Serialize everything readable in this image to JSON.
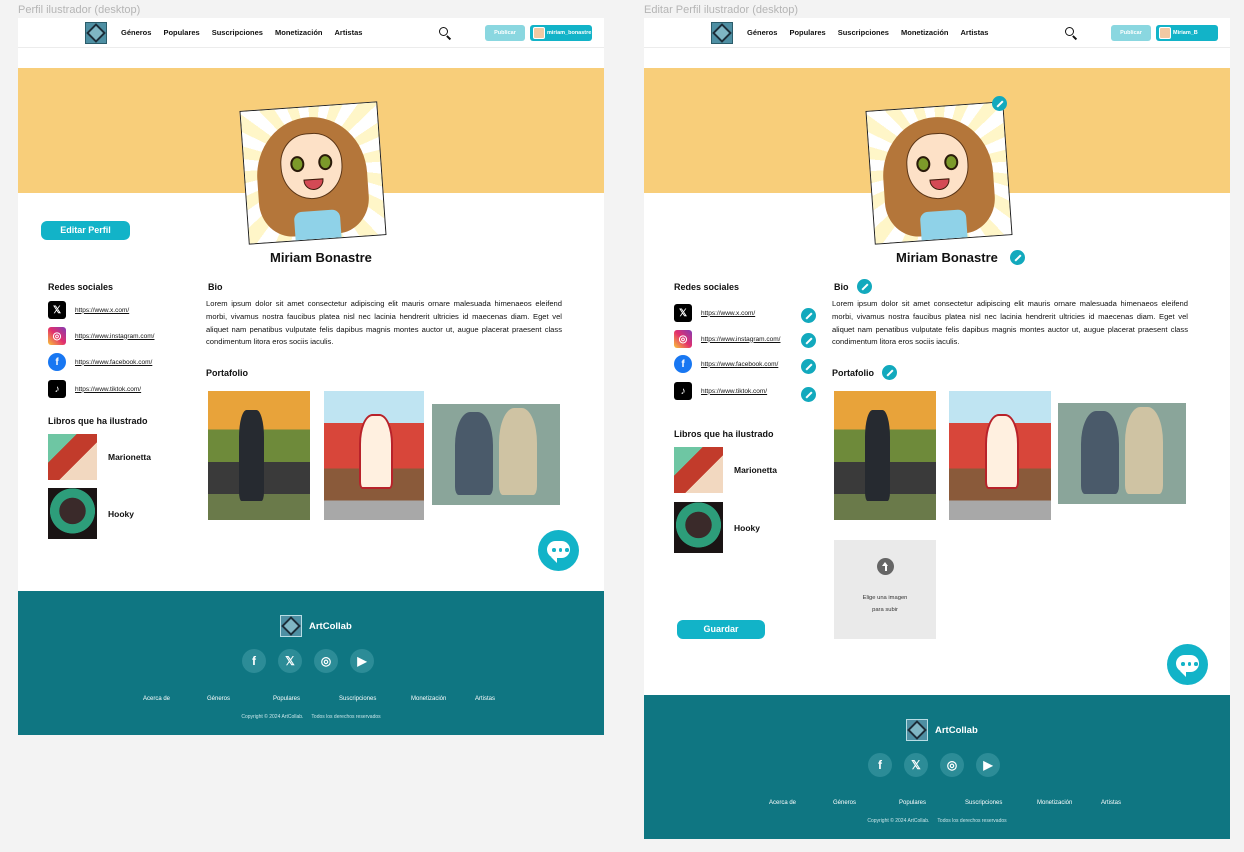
{
  "frames": {
    "view_label": "Perfil ilustrador (desktop)",
    "edit_label": "Editar Perfil ilustrador (desktop)"
  },
  "nav": {
    "links": [
      "Géneros",
      "Populares",
      "Suscripciones",
      "Monetización",
      "Artistas"
    ],
    "publish_label": "Publicar",
    "user_view": "miriam_bonastre",
    "user_edit": "Miriam_B"
  },
  "profile": {
    "name": "Miriam Bonastre",
    "edit_button": "Editar Perfil",
    "save_button": "Guardar"
  },
  "social": {
    "heading": "Redes sociales",
    "items": [
      {
        "icon": "x-icon",
        "url": "https://www.x.com/"
      },
      {
        "icon": "instagram-icon",
        "url": "https://www.instagram.com/"
      },
      {
        "icon": "facebook-icon",
        "url": "https://www.facebook.com/"
      },
      {
        "icon": "tiktok-icon",
        "url": "https://www.tiktok.com/"
      }
    ]
  },
  "books": {
    "heading": "Libros que ha ilustrado",
    "items": [
      "Marionetta",
      "Hooky"
    ]
  },
  "bio": {
    "heading": "Bio",
    "text": "Lorem ipsum dolor sit amet consectetur adipiscing elit mauris ornare malesuada himenaeos eleifend morbi, vivamus nostra faucibus platea nisl nec lacinia hendrerit ultricies id maecenas diam. Eget vel aliquet nam penatibus vulputate felis dapibus magnis montes auctor ut, augue placerat praesent class condimentum litora eros sociis iaculis."
  },
  "portfolio": {
    "heading": "Portafolio",
    "upload_text_1": "Elige una imagen",
    "upload_text_2": "para subir"
  },
  "footer": {
    "brand": "ArtCollab",
    "links": [
      "Acerca de",
      "Géneros",
      "Populares",
      "Suscripciones",
      "Monetización",
      "Artistas"
    ],
    "copyright": "Copyright © 2024 ArtCollab.",
    "rights": "Todos los derechos reservados"
  },
  "colors": {
    "accent": "#12b3c8",
    "banner": "#f8ce7a",
    "footer": "#0f7682"
  }
}
